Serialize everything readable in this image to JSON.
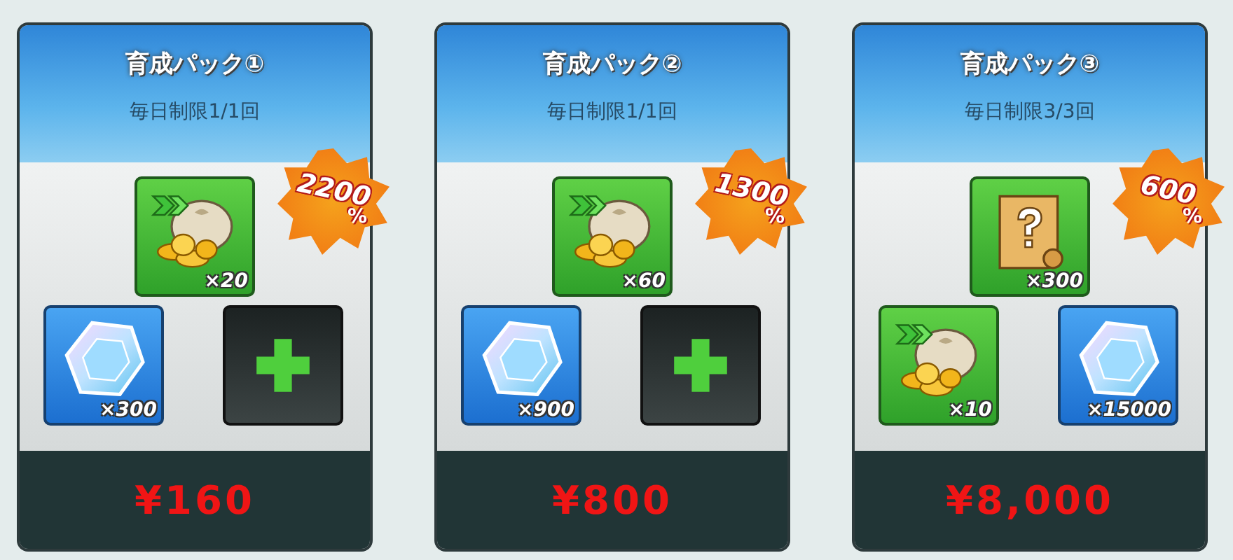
{
  "packs": [
    {
      "title": "育成パック①",
      "limit": "毎日制限1/1回",
      "bonus": "2200",
      "percent_sign": "%",
      "price": "¥160",
      "items": [
        {
          "kind": "coin-bag",
          "count": "×20"
        },
        {
          "kind": "gem",
          "count": "×300"
        },
        {
          "kind": "empty"
        }
      ]
    },
    {
      "title": "育成パック②",
      "limit": "毎日制限1/1回",
      "bonus": "1300",
      "percent_sign": "%",
      "price": "¥800",
      "items": [
        {
          "kind": "coin-bag",
          "count": "×60"
        },
        {
          "kind": "gem",
          "count": "×900"
        },
        {
          "kind": "empty"
        }
      ]
    },
    {
      "title": "育成パック③",
      "limit": "毎日制限3/3回",
      "bonus": "600",
      "percent_sign": "%",
      "price": "¥8,000",
      "items": [
        {
          "kind": "scroll",
          "count": "×300"
        },
        {
          "kind": "coin-bag",
          "count": "×10"
        },
        {
          "kind": "gem",
          "count": "×15000"
        }
      ]
    }
  ]
}
